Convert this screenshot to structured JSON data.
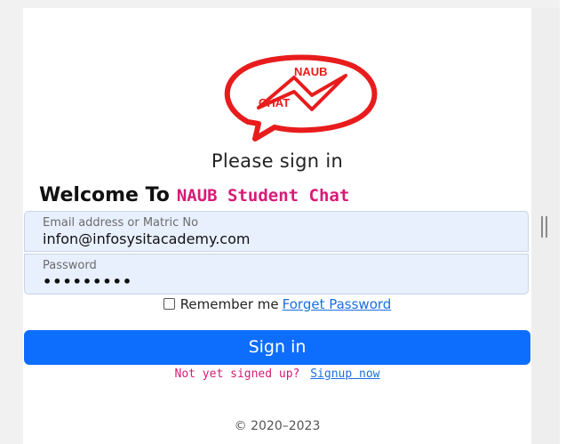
{
  "logo": {
    "text_line1": "NAUB",
    "text_line2": "CHAT",
    "color": "#e81c1c"
  },
  "form": {
    "heading": "Please sign in",
    "welcome_prefix": "Welcome To",
    "welcome_app": "NAUB Student Chat",
    "email": {
      "label": "Email address or Matric No",
      "value": "infon@infosysitacademy.com"
    },
    "password": {
      "label": "Password",
      "value": "•••••••••"
    },
    "remember_label": "Remember me",
    "remember_checked": false,
    "forget_password_label": "Forget Password",
    "submit_label": "Sign in",
    "signup_prompt": "Not yet signed up?",
    "signup_link": "Signup now"
  },
  "footer": {
    "copyright": "© 2020–2023"
  },
  "colors": {
    "primary": "#0d6efd",
    "accent_pink": "#d81b76",
    "input_bg": "#e8f0fe",
    "link": "#1a6fe0"
  }
}
